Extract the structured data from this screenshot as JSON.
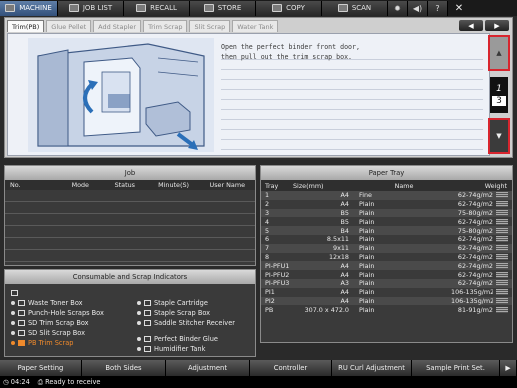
{
  "nav": {
    "machine": "MACHINE",
    "job_list": "JOB LIST",
    "recall": "RECALL",
    "store": "STORE",
    "copy": "COPY",
    "scan": "SCAN"
  },
  "tabs": [
    "Trim(PB)",
    "Glue Pellet",
    "Add Stapler",
    "Trim Scrap",
    "Slit Scrap",
    "Water Tank"
  ],
  "message": {
    "line1": "Open the perfect binder front door,",
    "line2": "then pull out the trim scrap box."
  },
  "pager": {
    "current": "1",
    "total": "3"
  },
  "job": {
    "title": "Job",
    "cols": [
      "No.",
      "Mode",
      "Status",
      "Minute(S)",
      "User Name"
    ]
  },
  "tray": {
    "title": "Paper Tray",
    "cols": [
      "Tray",
      "Size(mm)",
      "Name",
      "Weight"
    ],
    "rows": [
      {
        "tray": "1",
        "size": "A4",
        "name": "Fine",
        "weight": "62-74g/m2"
      },
      {
        "tray": "2",
        "size": "A4",
        "name": "Plain",
        "weight": "62-74g/m2"
      },
      {
        "tray": "3",
        "size": "B5",
        "name": "Plain",
        "weight": "75-80g/m2"
      },
      {
        "tray": "4",
        "size": "B5",
        "name": "Plain",
        "weight": "62-74g/m2"
      },
      {
        "tray": "5",
        "size": "B4",
        "name": "Plain",
        "weight": "75-80g/m2"
      },
      {
        "tray": "6",
        "size": "8.5x11",
        "name": "Plain",
        "weight": "62-74g/m2"
      },
      {
        "tray": "7",
        "size": "9x11",
        "name": "Plain",
        "weight": "62-74g/m2"
      },
      {
        "tray": "8",
        "size": "12x18",
        "name": "Plain",
        "weight": "62-74g/m2"
      },
      {
        "tray": "PI-PFU1",
        "size": "A4",
        "name": "Plain",
        "weight": "62-74g/m2"
      },
      {
        "tray": "PI-PFU2",
        "size": "A4",
        "name": "Plain",
        "weight": "62-74g/m2"
      },
      {
        "tray": "PI-PFU3",
        "size": "A3",
        "name": "Plain",
        "weight": "62-74g/m2"
      },
      {
        "tray": "PI1",
        "size": "A4",
        "name": "Plain",
        "weight": "106-135g/m2"
      },
      {
        "tray": "PI2",
        "size": "A4",
        "name": "Plain",
        "weight": "106-135g/m2"
      },
      {
        "tray": "PB",
        "size": "307.0 x 472.0",
        "name": "Plain",
        "weight": "81-91g/m2"
      }
    ]
  },
  "consumables": {
    "title": "Consumable and Scrap Indicators",
    "left": [
      "Waste Toner Box",
      "Punch-Hole Scraps Box",
      "SD Trim Scrap Box",
      "SD Slit Scrap Box",
      "PB Trim Scrap"
    ],
    "right": [
      "Staple Cartridge",
      "Staple Scrap Box",
      "Saddle Stitcher Receiver",
      "Perfect Binder Glue",
      "Humidifier Tank"
    ]
  },
  "bottom": [
    "Paper Setting",
    "Both Sides",
    "Adjustment",
    "Controller",
    "RU Curl Adjustment",
    "Sample Print Set."
  ],
  "status": {
    "time": "04:24",
    "text": "Ready to receive"
  },
  "colors": {
    "accent": "#33507a",
    "alert": "#d8252e",
    "warn": "#f08a2c"
  }
}
